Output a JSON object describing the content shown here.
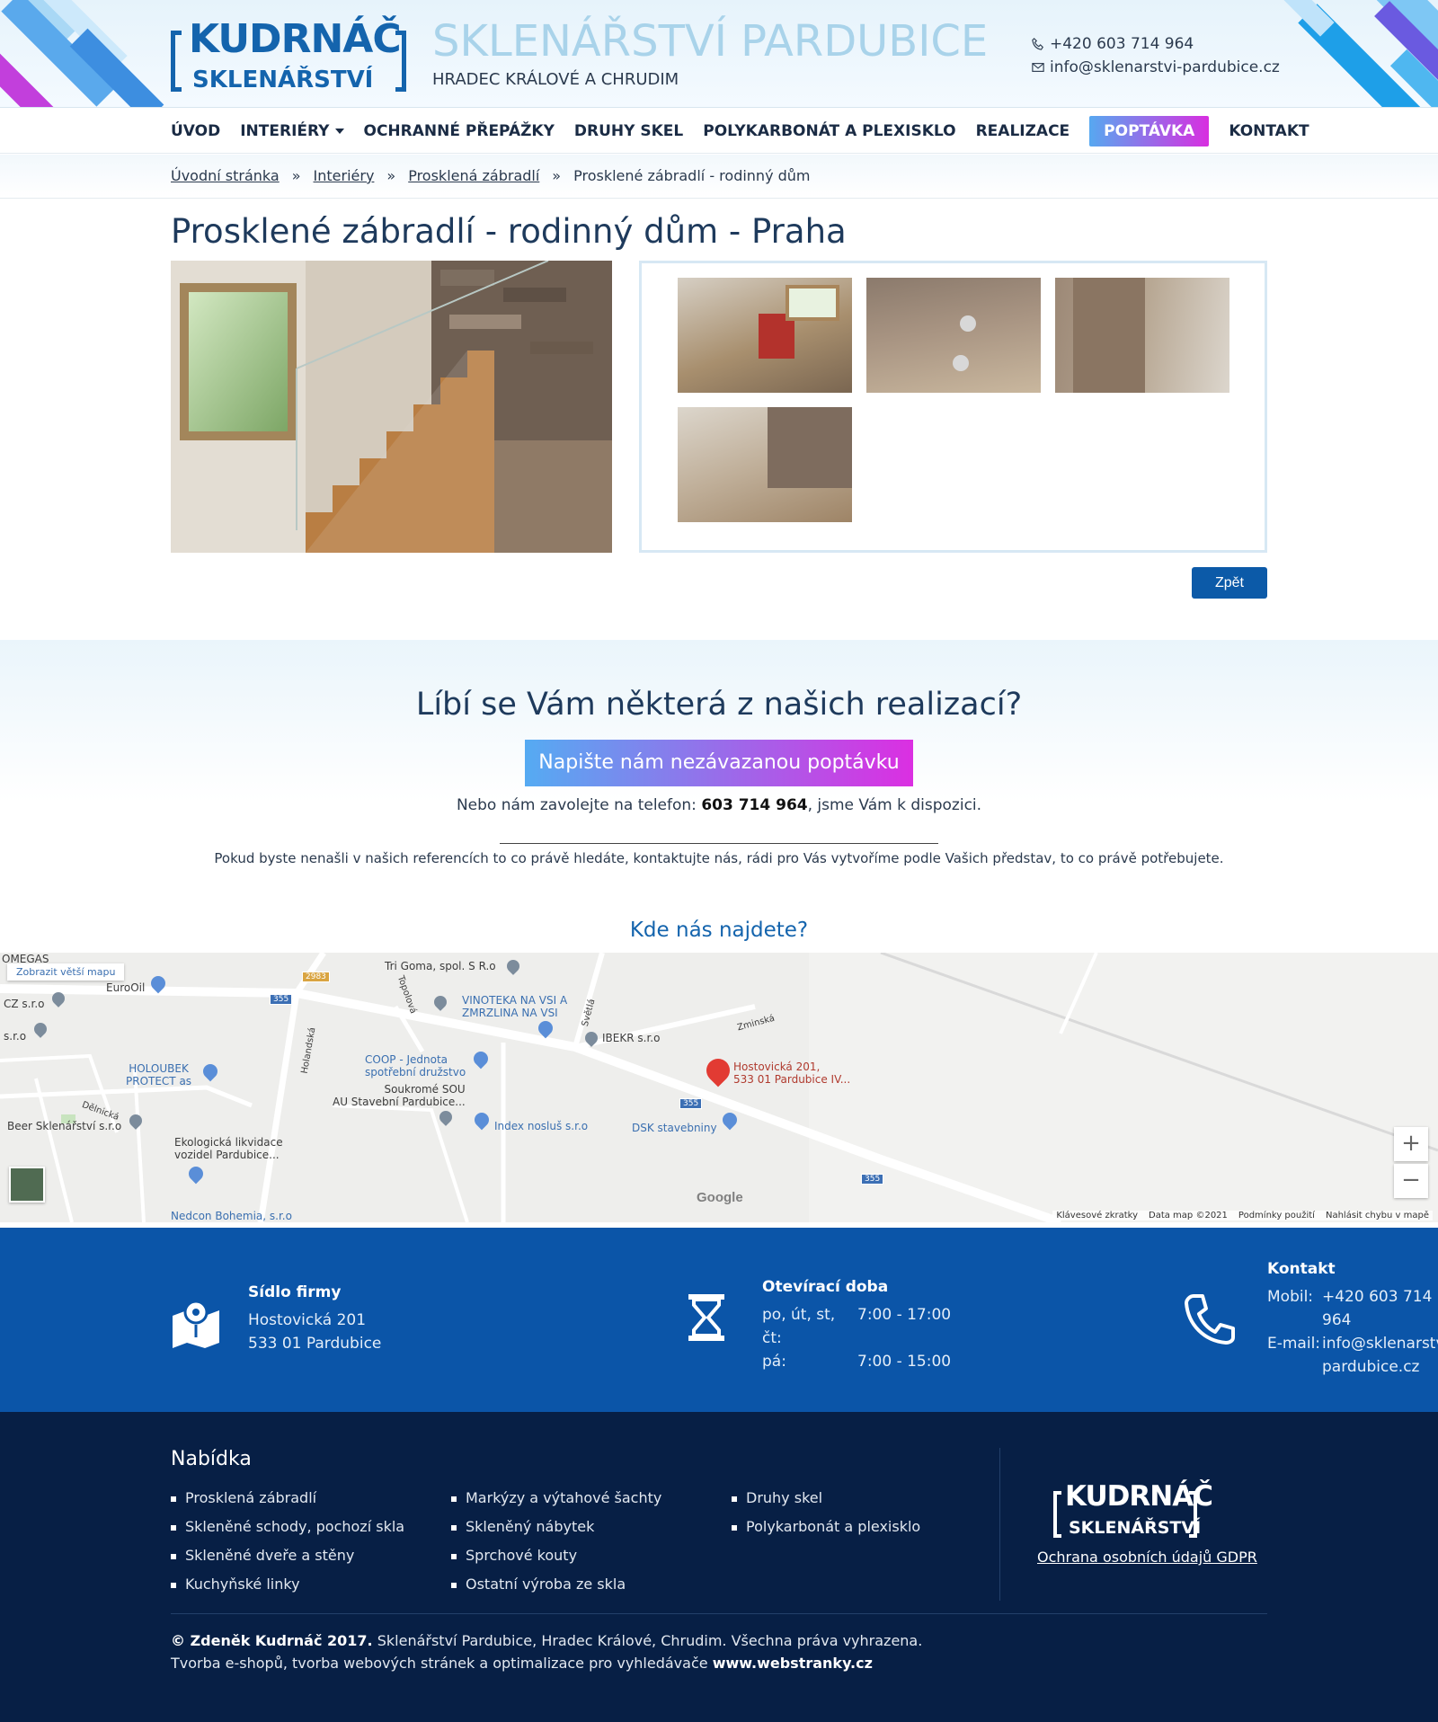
{
  "header": {
    "logo_line1": "KUDRNÁČ",
    "logo_line2": "SKLENÁŘSTVÍ",
    "site_title": "SKLENÁŘSTVÍ PARDUBICE",
    "site_subtitle": "HRADEC KRÁLOVÉ A CHRUDIM",
    "phone": "+420 603 714 964",
    "email": "info@sklenarstvi-pardubice.cz",
    "phone_icon": "phone-icon",
    "email_icon": "envelope-icon"
  },
  "nav": {
    "items": [
      {
        "label": "ÚVOD"
      },
      {
        "label": "INTERIÉRY"
      },
      {
        "label": "OCHRANNÉ PŘEPÁŽKY"
      },
      {
        "label": "DRUHY SKEL"
      },
      {
        "label": "POLYKARBONÁT A PLEXISKLO"
      },
      {
        "label": "REALIZACE"
      },
      {
        "label": "POPTÁVKA"
      },
      {
        "label": "KONTAKT"
      }
    ]
  },
  "breadcrumb": {
    "items": [
      "Úvodní stránka",
      "Interiéry",
      "Prosklená zábradlí"
    ],
    "current": "Prosklené zábradlí - rodinný dům",
    "separator": "»"
  },
  "page": {
    "title": "Prosklené zábradlí - rodinný dům - Praha",
    "back_button": "Zpět"
  },
  "cta": {
    "heading": "Líbí se Vám některá z našich realizací?",
    "button": "Napište nám nezávazanou poptávku",
    "phone_prefix": "Nebo nám zavolejte na telefon: ",
    "phone_number": "603 714 964",
    "phone_suffix": ", jsme Vám k dispozici.",
    "note": "Pokud byste nenašli v našich referencích to co právě hledáte, kontaktujte nás, rádi pro Vás vytvoříme podle Vašich představ, to co právě potřebujete."
  },
  "where": {
    "heading": "Kde nás najdete?"
  },
  "map": {
    "larger_map_link": "Zobrazit větší mapu",
    "main_place": "Hostovická 201,\n533 01 Pardubice IV...",
    "places": {
      "p1": "Tri Goma, spol. S R.o",
      "p2": "VINOTEKA NA VSI A\nZMRZLINA NA VSI",
      "p3": "IBEKR s.r.o",
      "p4": "COOP - Jednota\nspotřební družstvo",
      "p5": "Soukromé SOU\nAU Stavební Pardubice...",
      "p6": "Index nosluš s.r.o",
      "p7": "DSK stavebniny",
      "p8": "HOLOUBEK\nPROTECT as",
      "p9": "Beer Sklenářství s.r.o",
      "p10": "Ekologická likvidace\nvozidel Pardubice...",
      "p11": "Nedcon Bohemia, s.r.o",
      "p12": "EuroOil",
      "p13": "CZ s.r.o",
      "p14": "s.r.o",
      "p15": "OMEGAS",
      "street1": "Zminská",
      "street2": "Topolová",
      "street3": "Světlá",
      "street4": "Holandská",
      "street5": "Dělnická"
    },
    "road_labels": [
      "355",
      "355",
      "355",
      "2983"
    ],
    "google": "Google",
    "footer": [
      "Klávesové zkratky",
      "Data map ©2021",
      "Podmínky použití",
      "Nahlásit chybu v mapě"
    ],
    "zoom_in": "+",
    "zoom_out": "−"
  },
  "info": {
    "seat_title": "Sídlo firmy",
    "seat_line1": "Hostovická 201",
    "seat_line2": "533 01 Pardubice",
    "hours_title": "Otevírací doba",
    "hours": [
      {
        "days": "po, út, st, čt:",
        "time": "7:00 - 17:00"
      },
      {
        "days": "pá:",
        "time": "7:00 - 15:00"
      }
    ],
    "contact_title": "Kontakt",
    "mobile_label": "Mobil:",
    "mobile_value_1": "+420 603 714",
    "mobile_value_2": "964",
    "email_label": "E-mail:",
    "email_value_1": "info@sklenarstv",
    "email_value_2": "pardubice.cz"
  },
  "footer": {
    "offer_title": "Nabídka",
    "col1": [
      "Prosklená zábradlí",
      "Skleněné schody, pochozí skla",
      "Skleněné dveře a stěny",
      "Kuchyňské linky"
    ],
    "col2": [
      "Markýzy a výtahové šachty",
      "Skleněný nábytek",
      "Sprchové kouty",
      "Ostatní výroba ze skla"
    ],
    "col3": [
      "Druhy skel",
      "Polykarbonát a plexisklo"
    ],
    "logo_line1": "KUDRNÁČ",
    "logo_line2": "SKLENÁŘSTVÍ",
    "gdpr": "Ochrana osobních údajů GDPR",
    "copy_bold": "© Zdeněk Kudrnáč 2017.",
    "copy_rest": " Sklenářství Pardubice, Hradec Králové, Chrudim. Všechna práva vyhrazena.",
    "credit_prefix": "Tvorba e-shopů, tvorba webových stránek a optimalizace pro vyhledávače ",
    "credit_link": "www.webstranky.cz"
  }
}
